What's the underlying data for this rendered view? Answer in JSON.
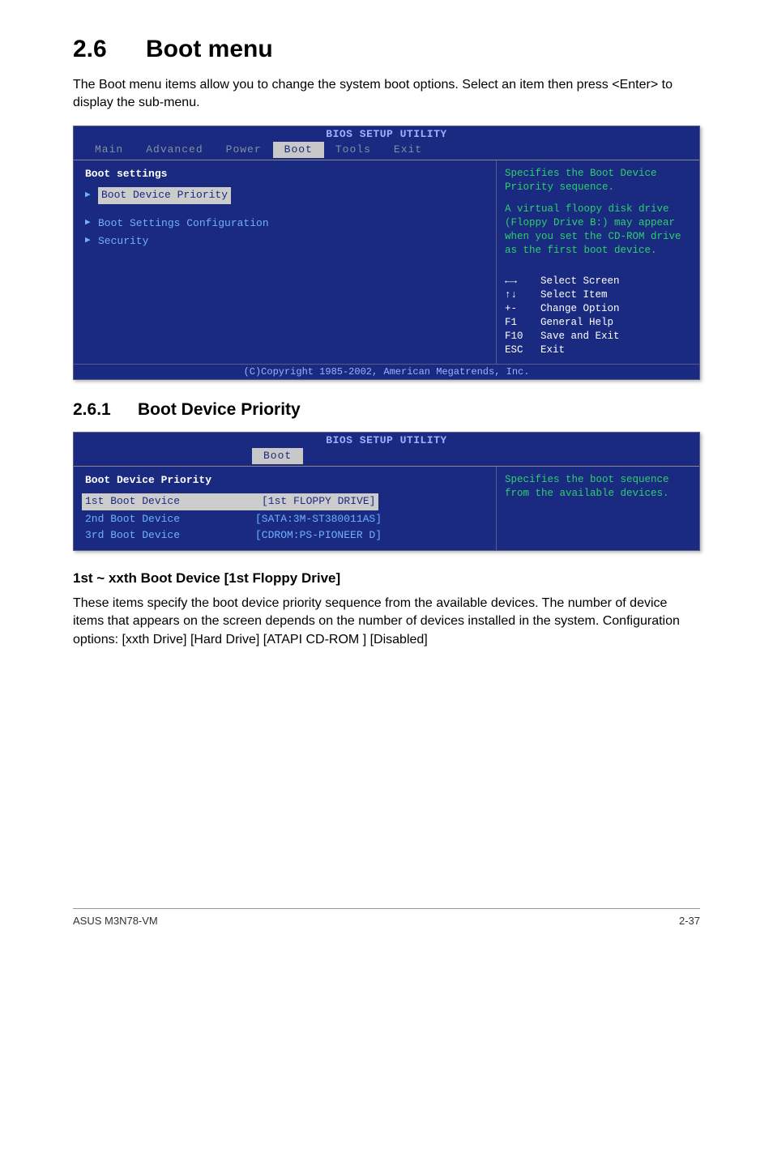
{
  "section": {
    "number": "2.6",
    "title": "Boot menu"
  },
  "intro": "The Boot menu items allow you to change the system boot options. Select an item then press <Enter> to display the sub-menu.",
  "bios1": {
    "header": "BIOS SETUP UTILITY",
    "tabs": [
      "Main",
      "Advanced",
      "Power",
      "Boot",
      "Tools",
      "Exit"
    ],
    "active_tab": "Boot",
    "heading": "Boot settings",
    "items": [
      "Boot Device Priority",
      "Boot Settings Configuration",
      "Security"
    ],
    "selected_item": "Boot Device Priority",
    "help1": "Specifies the Boot Device Priority sequence.",
    "help2": "A virtual floopy disk drive (Floppy Drive B:) may appear when you set the CD-ROM drive as the first boot device.",
    "keys": [
      {
        "k": "←→",
        "d": "Select Screen"
      },
      {
        "k": "↑↓",
        "d": "Select Item"
      },
      {
        "k": "+-",
        "d": "Change Option"
      },
      {
        "k": "F1",
        "d": "General Help"
      },
      {
        "k": "F10",
        "d": "Save and Exit"
      },
      {
        "k": "ESC",
        "d": "Exit"
      }
    ],
    "copyright": "(C)Copyright 1985-2002, American Megatrends, Inc."
  },
  "sub": {
    "number": "2.6.1",
    "title": "Boot Device Priority"
  },
  "bios2": {
    "header": "BIOS SETUP UTILITY",
    "active_tab": "Boot",
    "heading": "Boot Device Priority",
    "rows": [
      {
        "name": "1st Boot Device",
        "value": "[1st FLOPPY DRIVE]",
        "selected": true
      },
      {
        "name": "2nd Boot Device",
        "value": "[SATA:3M-ST380011AS]",
        "selected": false
      },
      {
        "name": "3rd Boot Device",
        "value": "[CDROM:PS-PIONEER D]",
        "selected": false
      }
    ],
    "help": "Specifies the boot sequence from the available devices."
  },
  "item_heading": "1st ~ xxth Boot Device [1st Floppy Drive]",
  "item_body": "These items specify the boot device priority sequence from the available devices. The number of device items that appears on the screen depends on the number of devices installed in the system. Configuration options: [xxth Drive] [Hard Drive] [ATAPI CD-ROM  ] [Disabled]",
  "footer": {
    "left": "ASUS M3N78-VM",
    "right": "2-37"
  }
}
